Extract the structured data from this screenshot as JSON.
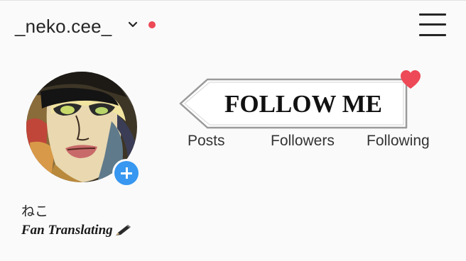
{
  "header": {
    "username": "_neko.cee_",
    "username_dropdown_icon": "chevron-down-icon",
    "notification_dot_color": "#ed4956",
    "menu_icon": "hamburger-menu-icon"
  },
  "profile": {
    "avatar_alt": "profile-avatar",
    "add_story_icon": "plus-icon",
    "add_story_color": "#3897f0",
    "banner_text": "FOLLOW ME",
    "banner_heart_color": "#ed4956",
    "stats": [
      {
        "label": "Posts"
      },
      {
        "label": "Followers"
      },
      {
        "label": "Following"
      }
    ],
    "display_name": "ねこ",
    "bio": "Fan Translating",
    "bio_icon": "pen-icon"
  }
}
